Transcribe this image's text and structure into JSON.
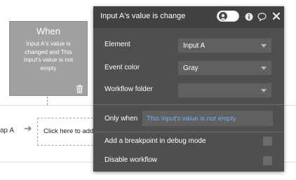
{
  "canvas": {
    "step_label": "ap A",
    "add_action_label": "Click here to add"
  },
  "when_card": {
    "title": "When",
    "description": "Input A's value is changed and This Input's value is not empty"
  },
  "panel": {
    "title": "Input A's value is change",
    "element": {
      "label": "Element",
      "value": "Input A"
    },
    "event_color": {
      "label": "Event color",
      "value": "Gray"
    },
    "workflow_folder": {
      "label": "Workflow folder",
      "value": ""
    },
    "only_when": {
      "label": "Only when",
      "value": "This Input's value is not empty"
    },
    "breakpoint": {
      "label": "Add a breakpoint in debug mode",
      "checked": false
    },
    "disable": {
      "label": "Disable workflow",
      "checked": false
    }
  },
  "colors": {
    "panel_bg": "#4f4f4f",
    "header_bg": "#414141",
    "card_bg": "#a0a0a0",
    "expression_text": "#76aef0"
  },
  "icons": [
    "trash-icon",
    "person-icon",
    "info-icon",
    "comment-icon",
    "close-icon",
    "chevron-down-icon",
    "arrow-right-icon"
  ]
}
